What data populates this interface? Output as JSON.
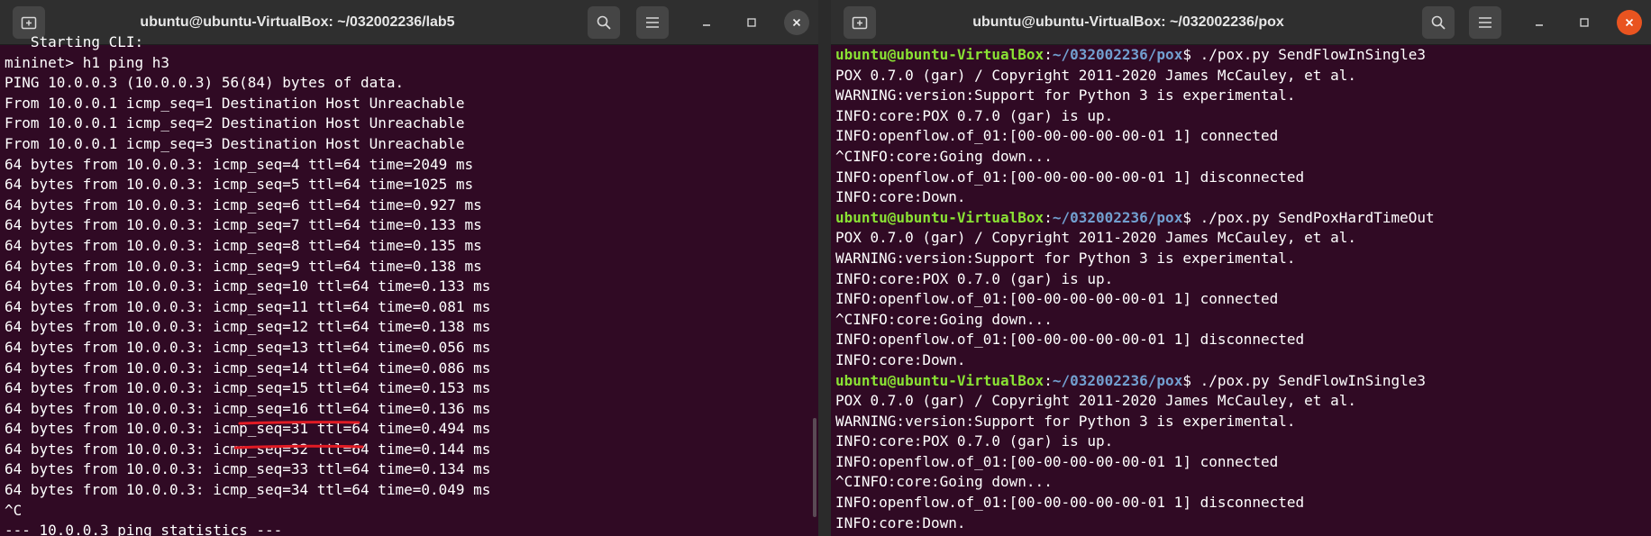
{
  "left_window": {
    "title": "ubuntu@ubuntu-VirtualBox: ~/032002236/lab5",
    "active": false,
    "lines": [
      "   Starting CLI:",
      "mininet> h1 ping h3",
      "PING 10.0.0.3 (10.0.0.3) 56(84) bytes of data.",
      "From 10.0.0.1 icmp_seq=1 Destination Host Unreachable",
      "From 10.0.0.1 icmp_seq=2 Destination Host Unreachable",
      "From 10.0.0.1 icmp_seq=3 Destination Host Unreachable",
      "64 bytes from 10.0.0.3: icmp_seq=4 ttl=64 time=2049 ms",
      "64 bytes from 10.0.0.3: icmp_seq=5 ttl=64 time=1025 ms",
      "64 bytes from 10.0.0.3: icmp_seq=6 ttl=64 time=0.927 ms",
      "64 bytes from 10.0.0.3: icmp_seq=7 ttl=64 time=0.133 ms",
      "64 bytes from 10.0.0.3: icmp_seq=8 ttl=64 time=0.135 ms",
      "64 bytes from 10.0.0.3: icmp_seq=9 ttl=64 time=0.138 ms",
      "64 bytes from 10.0.0.3: icmp_seq=10 ttl=64 time=0.133 ms",
      "64 bytes from 10.0.0.3: icmp_seq=11 ttl=64 time=0.081 ms",
      "64 bytes from 10.0.0.3: icmp_seq=12 ttl=64 time=0.138 ms",
      "64 bytes from 10.0.0.3: icmp_seq=13 ttl=64 time=0.056 ms",
      "64 bytes from 10.0.0.3: icmp_seq=14 ttl=64 time=0.086 ms",
      "64 bytes from 10.0.0.3: icmp_seq=15 ttl=64 time=0.153 ms",
      "64 bytes from 10.0.0.3: icmp_seq=16 ttl=64 time=0.136 ms",
      "64 bytes from 10.0.0.3: icmp_seq=31 ttl=64 time=0.494 ms",
      "64 bytes from 10.0.0.3: icmp_seq=32 ttl=64 time=0.144 ms",
      "64 bytes from 10.0.0.3: icmp_seq=33 ttl=64 time=0.134 ms",
      "64 bytes from 10.0.0.3: icmp_seq=34 ttl=64 time=0.049 ms",
      "^C",
      "--- 10.0.0.3 ping statistics ---"
    ]
  },
  "right_window": {
    "title": "ubuntu@ubuntu-VirtualBox: ~/032002236/pox",
    "active": true,
    "prompt": {
      "user": "ubuntu@ubuntu-VirtualBox",
      "sep": ":",
      "path": "~/032002236/pox",
      "symbol": "$ "
    },
    "lines": [
      {
        "type": "prompt",
        "command": "./pox.py SendFlowInSingle3"
      },
      {
        "type": "text",
        "text": "POX 0.7.0 (gar) / Copyright 2011-2020 James McCauley, et al."
      },
      {
        "type": "text",
        "text": "WARNING:version:Support for Python 3 is experimental."
      },
      {
        "type": "text",
        "text": "INFO:core:POX 0.7.0 (gar) is up."
      },
      {
        "type": "text",
        "text": "INFO:openflow.of_01:[00-00-00-00-00-01 1] connected"
      },
      {
        "type": "text",
        "text": "^CINFO:core:Going down..."
      },
      {
        "type": "text",
        "text": "INFO:openflow.of_01:[00-00-00-00-00-01 1] disconnected"
      },
      {
        "type": "text",
        "text": "INFO:core:Down."
      },
      {
        "type": "prompt",
        "command": "./pox.py SendPoxHardTimeOut"
      },
      {
        "type": "text",
        "text": "POX 0.7.0 (gar) / Copyright 2011-2020 James McCauley, et al."
      },
      {
        "type": "text",
        "text": "WARNING:version:Support for Python 3 is experimental."
      },
      {
        "type": "text",
        "text": "INFO:core:POX 0.7.0 (gar) is up."
      },
      {
        "type": "text",
        "text": "INFO:openflow.of_01:[00-00-00-00-00-01 1] connected"
      },
      {
        "type": "text",
        "text": "^CINFO:core:Going down..."
      },
      {
        "type": "text",
        "text": "INFO:openflow.of_01:[00-00-00-00-00-01 1] disconnected"
      },
      {
        "type": "text",
        "text": "INFO:core:Down."
      },
      {
        "type": "prompt",
        "command": "./pox.py SendFlowInSingle3"
      },
      {
        "type": "text",
        "text": "POX 0.7.0 (gar) / Copyright 2011-2020 James McCauley, et al."
      },
      {
        "type": "text",
        "text": "WARNING:version:Support for Python 3 is experimental."
      },
      {
        "type": "text",
        "text": "INFO:core:POX 0.7.0 (gar) is up."
      },
      {
        "type": "text",
        "text": "INFO:openflow.of_01:[00-00-00-00-00-01 1] connected"
      },
      {
        "type": "text",
        "text": "^CINFO:core:Going down..."
      },
      {
        "type": "text",
        "text": "INFO:openflow.of_01:[00-00-00-00-00-01 1] disconnected"
      },
      {
        "type": "text",
        "text": "INFO:core:Down."
      }
    ]
  },
  "titlebar_buttons": [
    "new-tab-icon",
    "search-icon",
    "hamburger-menu-icon",
    "minimize-icon",
    "maximize-icon",
    "close-icon"
  ],
  "colors": {
    "terminal_bg": "#300a24",
    "titlebar_bg": "#2f2f2f",
    "prompt_user": "#8ae234",
    "prompt_path": "#729fcf",
    "annotation": "#e01b24",
    "close_active": "#e95420"
  }
}
